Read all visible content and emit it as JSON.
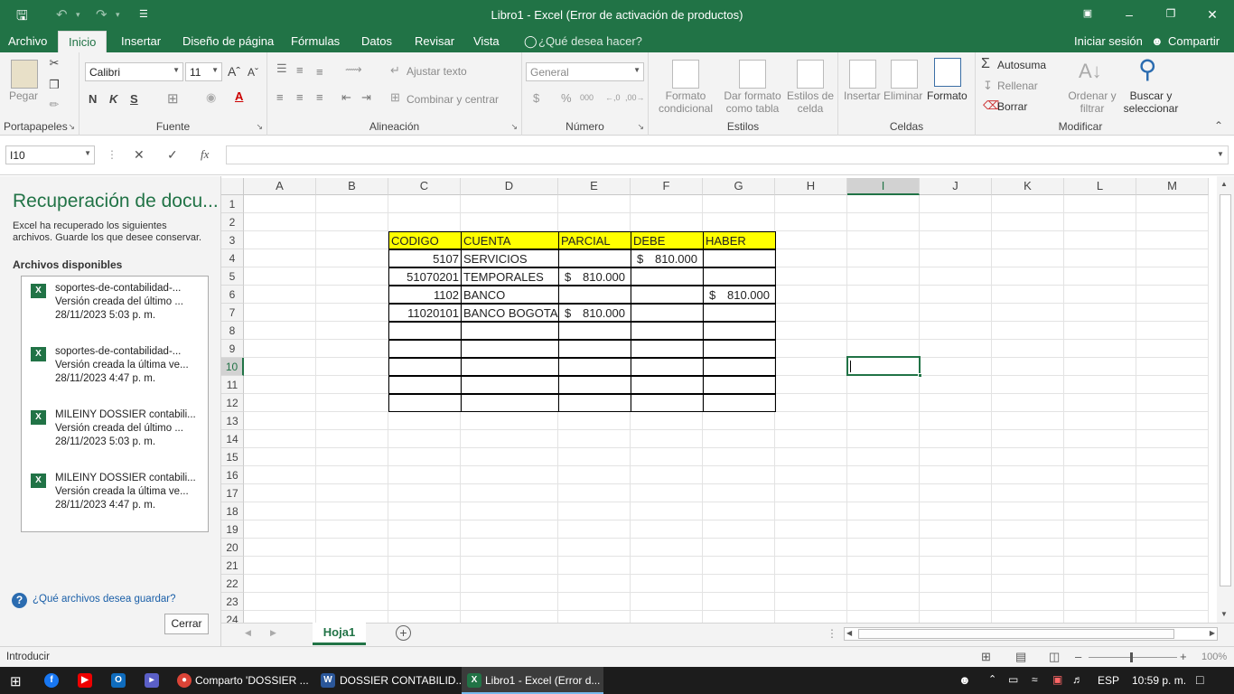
{
  "window": {
    "title": "Libro1 - Excel (Error de activación de productos)"
  },
  "ribbon_tabs": [
    "Archivo",
    "Inicio",
    "Insertar",
    "Diseño de página",
    "Fórmulas",
    "Datos",
    "Revisar",
    "Vista"
  ],
  "tell_me": "¿Qué desea hacer?",
  "signin": "Iniciar sesión",
  "share": "Compartir",
  "clipboard": {
    "paste": "Pegar",
    "label": "Portapapeles"
  },
  "font": {
    "name": "Calibri",
    "size": "11",
    "bold": "N",
    "italic": "K",
    "underline": "S",
    "label": "Fuente"
  },
  "alignment": {
    "wrap": "Ajustar texto",
    "merge": "Combinar y centrar",
    "label": "Alineación"
  },
  "number": {
    "format": "General",
    "currency": "$",
    "percent": "%",
    "thousands": "000",
    "label": "Número"
  },
  "styles": {
    "conditional1": "Formato",
    "conditional2": "condicional",
    "table1": "Dar formato",
    "table2": "como tabla",
    "cell1": "Estilos de",
    "cell2": "celda",
    "label": "Estilos"
  },
  "cells": {
    "insert": "Insertar",
    "delete": "Eliminar",
    "format": "Formato",
    "label": "Celdas"
  },
  "editing": {
    "autosum": "Autosuma",
    "fill": "Rellenar",
    "clear": "Borrar",
    "sort1": "Ordenar y",
    "sort2": "filtrar",
    "find1": "Buscar y",
    "find2": "seleccionar",
    "label": "Modificar"
  },
  "formula_bar": {
    "name_box": "I10",
    "formula": ""
  },
  "recovery": {
    "title": "Recuperación de docu...",
    "desc1": "Excel ha recuperado los siguientes",
    "desc2": "archivos. Guarde los que desee conservar.",
    "available": "Archivos disponibles",
    "files": [
      {
        "name": "soportes-de-contabilidad-...",
        "version": "Versión creada del último ...",
        "date": "28/11/2023 5:03 p. m."
      },
      {
        "name": "soportes-de-contabilidad-...",
        "version": "Versión creada la última ve...",
        "date": "28/11/2023 4:47 p. m."
      },
      {
        "name": "MILEINY DOSSIER contabili...",
        "version": "Versión creada del último ...",
        "date": "28/11/2023 5:03 p. m."
      },
      {
        "name": "MILEINY DOSSIER contabili...",
        "version": "Versión creada la última ve...",
        "date": "28/11/2023 4:47 p. m."
      }
    ],
    "help": "¿Qué archivos desea guardar?",
    "close": "Cerrar"
  },
  "columns": [
    "A",
    "B",
    "C",
    "D",
    "E",
    "F",
    "G",
    "H",
    "I",
    "J",
    "K",
    "L",
    "M"
  ],
  "rows": [
    "1",
    "2",
    "3",
    "4",
    "5",
    "6",
    "7",
    "8",
    "9",
    "10",
    "11",
    "12",
    "13",
    "14",
    "15",
    "16",
    "17",
    "18",
    "19",
    "20",
    "21",
    "22",
    "23",
    "24"
  ],
  "table": {
    "headers": [
      "CODIGO",
      "CUENTA",
      "PARCIAL",
      "DEBE",
      "HABER"
    ],
    "rows": [
      {
        "codigo": "5107",
        "cuenta": "SERVICIOS",
        "parcial": "",
        "debe": "810.000",
        "haber": ""
      },
      {
        "codigo": "51070201",
        "cuenta": "TEMPORALES",
        "parcial": "810.000",
        "debe": "",
        "haber": ""
      },
      {
        "codigo": "1102",
        "cuenta": "BANCO",
        "parcial": "",
        "debe": "",
        "haber": "810.000"
      },
      {
        "codigo": "11020101",
        "cuenta": "BANCO BOGOTA",
        "parcial": "810.000",
        "debe": "",
        "haber": ""
      }
    ],
    "currency": "$"
  },
  "sheet_tab": "Hoja1",
  "status": {
    "mode": "Introducir",
    "zoom": "100%"
  },
  "taskbar": {
    "items": [
      "Comparto 'DOSSIER ...",
      "DOSSIER CONTABILID...",
      "Libro1 - Excel (Error d..."
    ],
    "lang": "ESP",
    "time": "10:59 p. m."
  },
  "colors": {
    "excel_green": "#217346",
    "header_yellow": "#ffff00"
  }
}
